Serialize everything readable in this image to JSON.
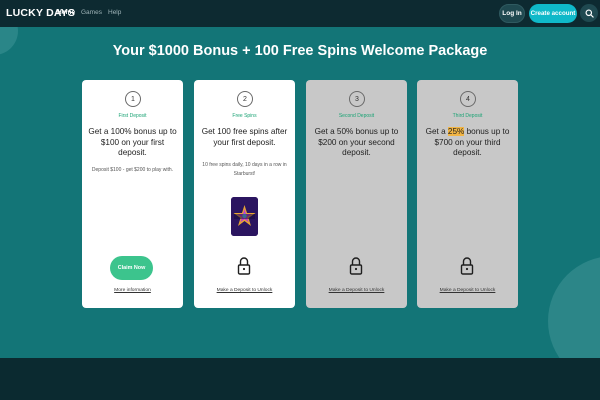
{
  "nav": {
    "logo": "LUCKY DAYS",
    "links": [
      "Home",
      "Games",
      "Help"
    ],
    "login_label": "Log In",
    "create_account_label": "Create account",
    "search_icon": "search-icon"
  },
  "hero": {
    "title": "Your $1000 Bonus + 100 Free Spins Welcome Package"
  },
  "cards": [
    {
      "step": "1",
      "label": "First Deposit",
      "headline": "Get a 100% bonus up to $100 on your first deposit.",
      "sub": "Deposit $100 - get $200 to play with.",
      "button": "Claim Now",
      "link": "More information",
      "locked": false
    },
    {
      "step": "2",
      "label": "Free Spins",
      "headline": "Get 100 free spins after your first deposit.",
      "sub": "10 free spins daily, 10 days in a row in Starburst!",
      "game": "starburst-thumbnail",
      "link": "Make a Deposit to Unlock",
      "locked": false
    },
    {
      "step": "3",
      "label": "Second Deposit",
      "headline": "Get a 50% bonus up to $200 on your second deposit.",
      "link": "Make a Deposit to Unlock",
      "locked": true
    },
    {
      "step": "4",
      "label": "Third Deposit",
      "headline_pre": "Get a ",
      "headline_hl": "25%",
      "headline_post": " bonus up to $700 on your third deposit.",
      "link": "Make a Deposit to Unlock",
      "locked": true
    }
  ],
  "colors": {
    "brand_teal": "#137577",
    "accent_cyan": "#0fb9c9",
    "claim_green": "#3cc48d",
    "label_green": "#1aa374",
    "dark_bg": "#0c2a30",
    "highlight": "#f2b544"
  }
}
